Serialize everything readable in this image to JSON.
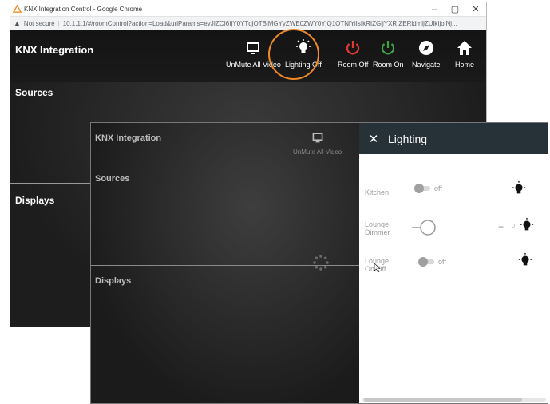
{
  "back_window": {
    "tab_title": "KNX Integration Control - Google Chrome",
    "security_label": "Not secure",
    "url": "10.1.1.1/#/roomControl?action=Load&uriParams=eyJIZCI6IjY0YTdjOTBiMGYyZWE0ZWY0YjQ1OTNlYiIsIkRIZGljYXRIZERldmljZUlkIjoiNj...",
    "window_controls": {
      "minimize": "–",
      "maximize": "▢",
      "close": "✕"
    },
    "app_title": "KNX Integration",
    "nav": {
      "unmute": "UnMute All Video",
      "lighting": "Lighting Off",
      "room_off": "Room Off",
      "room_on": "Room On",
      "navigate": "Navigate",
      "home": "Home"
    },
    "sources_label": "Sources",
    "displays_label": "Displays"
  },
  "front_window": {
    "app_title": "KNX Integration",
    "unmute_label": "UnMute All Video",
    "sources_label": "Sources",
    "displays_label": "Displays",
    "panel": {
      "close_glyph": "✕",
      "title": "Lighting",
      "kitchen": {
        "name": "Kitchen",
        "state": "off"
      },
      "lounge_dimmer": {
        "name_line1": "Lounge",
        "name_line2": "Dimmer",
        "plus": "+",
        "value": "0"
      },
      "lounge_onoff": {
        "name_line1": "Lounge",
        "name_line2": "On/Off",
        "state": "off"
      }
    }
  },
  "colors": {
    "highlight": "#f08a24",
    "room_off": "#e53935",
    "room_on": "#43a047",
    "panel_header": "#263238"
  },
  "icons": {
    "monitor": "monitor-icon",
    "lightbulb": "lightbulb-icon",
    "power_off": "power-off-icon",
    "power_on": "power-on-icon",
    "compass": "compass-icon",
    "home": "home-icon",
    "warning": "warning-icon",
    "spinner": "spinner-icon",
    "cursor": "cursor-icon"
  }
}
